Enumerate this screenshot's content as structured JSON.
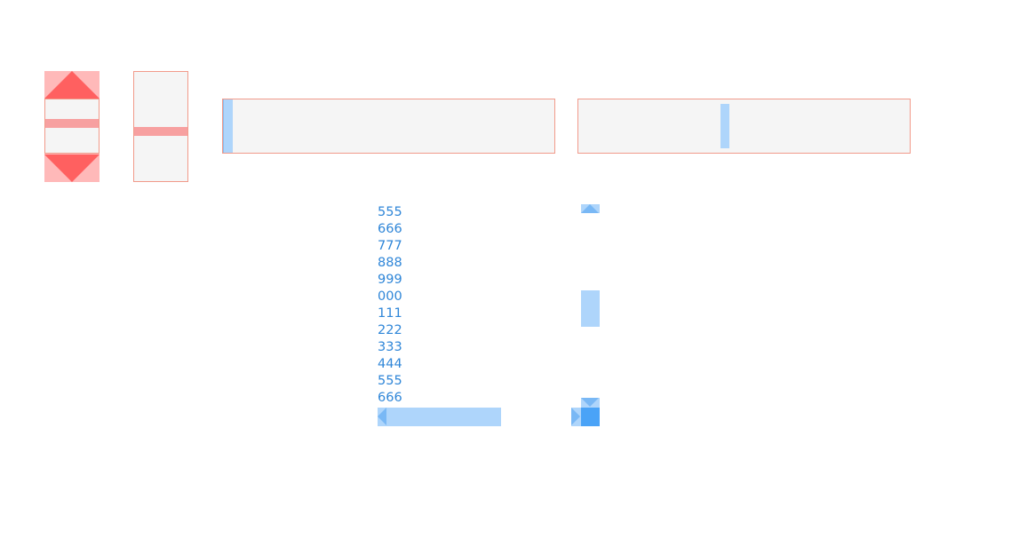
{
  "colors": {
    "stepper_bg": "#ffb9b9",
    "stepper_arrow": "#ff6060",
    "track_bg": "#f5f5f5",
    "track_border": "#f19a8a",
    "red_thumb": "#f7a0a0",
    "blue_thumb": "#aed5fb",
    "blue_arrow": "#79b8f5",
    "blue_corner": "#4aa3f7",
    "list_text": "#2f86d8"
  },
  "controls": {
    "stepper_value": 0.5,
    "vertical_slider_value": 0.55,
    "horizontal_slider_1_value": 0.0,
    "horizontal_slider_2_value": 0.44
  },
  "list": {
    "items": [
      "555",
      "666",
      "777",
      "888",
      "999",
      "000",
      "111",
      "222",
      "333",
      "444",
      "555",
      "666"
    ]
  }
}
